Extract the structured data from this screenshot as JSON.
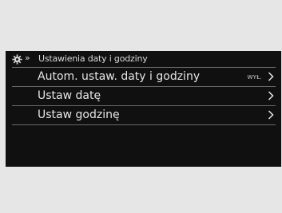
{
  "header": {
    "icon": "gear-icon",
    "breadcrumb_separator": "»",
    "title": "Ustawienia daty i godziny"
  },
  "menu": {
    "items": [
      {
        "label": "Autom. ustaw. daty i godziny",
        "value": "WYŁ.",
        "icon": "chevron-right-icon"
      },
      {
        "label": "Ustaw datę",
        "value": "",
        "icon": "chevron-right-icon"
      },
      {
        "label": "Ustaw godzinę",
        "value": "",
        "icon": "chevron-right-icon"
      }
    ]
  },
  "colors": {
    "frame_background": "#e6e6e6",
    "screen_background": "#101010",
    "text": "#e6e6e6",
    "divider": "#6a6a6a"
  }
}
